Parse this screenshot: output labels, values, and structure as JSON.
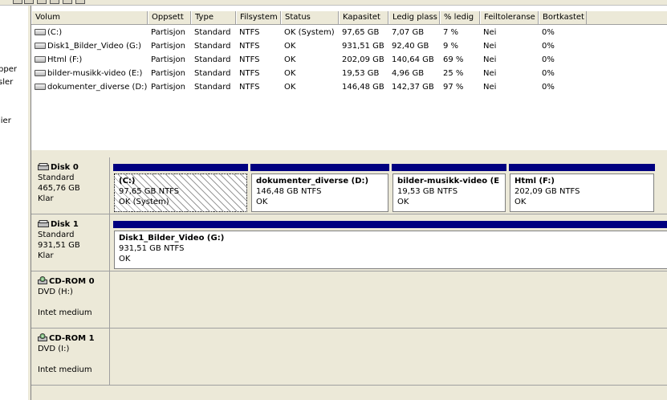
{
  "left_pane": {
    "fragments": [
      "pper",
      "sler",
      "lier"
    ]
  },
  "volume_list": {
    "columns": [
      "Volum",
      "Oppsett",
      "Type",
      "Filsystem",
      "Status",
      "Kapasitet",
      "Ledig plass",
      "% ledig",
      "Feiltoleranse",
      "Bortkastet"
    ],
    "rows": [
      {
        "volume": "(C:)",
        "layout": "Partisjon",
        "type": "Standard",
        "fs": "NTFS",
        "status": "OK (System)",
        "capacity": "97,65 GB",
        "free": "7,07 GB",
        "pct_free": "7 %",
        "fault_tolerance": "Nei",
        "overhead": "0%"
      },
      {
        "volume": "Disk1_Bilder_Video (G:)",
        "layout": "Partisjon",
        "type": "Standard",
        "fs": "NTFS",
        "status": "OK",
        "capacity": "931,51 GB",
        "free": "92,40 GB",
        "pct_free": "9 %",
        "fault_tolerance": "Nei",
        "overhead": "0%"
      },
      {
        "volume": "Html (F:)",
        "layout": "Partisjon",
        "type": "Standard",
        "fs": "NTFS",
        "status": "OK",
        "capacity": "202,09 GB",
        "free": "140,64 GB",
        "pct_free": "69 %",
        "fault_tolerance": "Nei",
        "overhead": "0%"
      },
      {
        "volume": "bilder-musikk-video (E:)",
        "layout": "Partisjon",
        "type": "Standard",
        "fs": "NTFS",
        "status": "OK",
        "capacity": "19,53 GB",
        "free": "4,96 GB",
        "pct_free": "25 %",
        "fault_tolerance": "Nei",
        "overhead": "0%"
      },
      {
        "volume": "dokumenter_diverse (D:)",
        "layout": "Partisjon",
        "type": "Standard",
        "fs": "NTFS",
        "status": "OK",
        "capacity": "146,48 GB",
        "free": "142,37 GB",
        "pct_free": "97 %",
        "fault_tolerance": "Nei",
        "overhead": "0%"
      }
    ]
  },
  "disks": [
    {
      "name": "Disk 0",
      "type": "Standard",
      "size": "465,76 GB",
      "state": "Klar",
      "partitions": [
        {
          "name": "(C:)",
          "size_fs": "97,65 GB NTFS",
          "status": "OK (System)"
        },
        {
          "name": "dokumenter_diverse  (D:)",
          "size_fs": "146,48 GB NTFS",
          "status": "OK"
        },
        {
          "name": "bilder-musikk-video  (E",
          "size_fs": "19,53 GB NTFS",
          "status": "OK"
        },
        {
          "name": "Html  (F:)",
          "size_fs": "202,09 GB NTFS",
          "status": "OK"
        }
      ]
    },
    {
      "name": "Disk 1",
      "type": "Standard",
      "size": "931,51 GB",
      "state": "Klar",
      "partitions": [
        {
          "name": "Disk1_Bilder_Video  (G:)",
          "size_fs": "931,51 GB NTFS",
          "status": "OK"
        }
      ]
    },
    {
      "name": "CD-ROM 0",
      "type": "DVD (H:)",
      "state": "Intet medium",
      "partitions": []
    },
    {
      "name": "CD-ROM 1",
      "type": "DVD (I:)",
      "state": "Intet medium",
      "partitions": []
    }
  ],
  "colors": {
    "partition_bar": "#000080",
    "panel_bg": "#ece9d8",
    "selected_hatch": "#9a9a9a"
  },
  "icons": {
    "volume": "drive-icon",
    "disk": "hard-disk-icon",
    "cdrom": "cd-rom-icon"
  }
}
